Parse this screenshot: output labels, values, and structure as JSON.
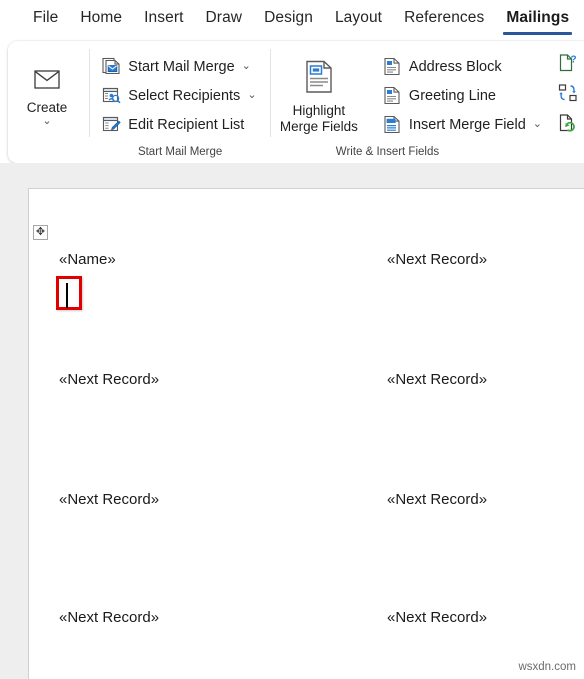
{
  "app": {
    "name": "Microsoft Word",
    "accent_color": "#2b579a"
  },
  "tabs": [
    {
      "label": "File",
      "active": false
    },
    {
      "label": "Home",
      "active": false
    },
    {
      "label": "Insert",
      "active": false
    },
    {
      "label": "Draw",
      "active": false
    },
    {
      "label": "Design",
      "active": false
    },
    {
      "label": "Layout",
      "active": false
    },
    {
      "label": "References",
      "active": false
    },
    {
      "label": "Mailings",
      "active": true
    }
  ],
  "ribbon": {
    "groups": [
      {
        "title": "Create",
        "big_button": {
          "label": "Create",
          "icon": "envelope-icon",
          "has_dropdown": true,
          "dropdown_glyph": "⌄"
        }
      },
      {
        "title": "Start Mail Merge",
        "items": [
          {
            "label": "Start Mail Merge",
            "icon": "start-mail-merge-icon",
            "has_dropdown": true,
            "dropdown_glyph": "⌄"
          },
          {
            "label": "Select Recipients",
            "icon": "select-recipients-icon",
            "has_dropdown": true,
            "dropdown_glyph": "⌄"
          },
          {
            "label": "Edit Recipient List",
            "icon": "edit-recipient-list-icon",
            "has_dropdown": false,
            "dropdown_glyph": ""
          }
        ]
      },
      {
        "title": "Write & Insert Fields",
        "big_button": {
          "label": "Highlight\nMerge Fields",
          "label_line1": "Highlight",
          "label_line2": "Merge Fields",
          "icon": "highlight-merge-fields-icon",
          "has_dropdown": false
        },
        "items": [
          {
            "label": "Address Block",
            "icon": "address-block-icon",
            "has_dropdown": false,
            "dropdown_glyph": ""
          },
          {
            "label": "Greeting Line",
            "icon": "greeting-line-icon",
            "has_dropdown": false,
            "dropdown_glyph": ""
          },
          {
            "label": "Insert Merge Field",
            "icon": "insert-merge-field-icon",
            "has_dropdown": true,
            "dropdown_glyph": "⌄"
          }
        ],
        "icon_only_items": [
          {
            "name": "rules-icon",
            "tooltip": "Rules"
          },
          {
            "name": "match-fields-icon",
            "tooltip": "Match Fields"
          },
          {
            "name": "update-labels-icon",
            "tooltip": "Update Labels"
          }
        ]
      }
    ]
  },
  "document": {
    "table_move_handle_glyph": "✥",
    "merge_field_name": "«Name»",
    "next_record_field": "«Next Record»",
    "cells": [
      {
        "row": 0,
        "col": 0,
        "text": "«Name»"
      },
      {
        "row": 0,
        "col": 1,
        "text": "«Next Record»"
      },
      {
        "row": 1,
        "col": 0,
        "text": "«Next Record»"
      },
      {
        "row": 1,
        "col": 1,
        "text": "«Next Record»"
      },
      {
        "row": 2,
        "col": 0,
        "text": "«Next Record»"
      },
      {
        "row": 2,
        "col": 1,
        "text": "«Next Record»"
      },
      {
        "row": 3,
        "col": 0,
        "text": "«Next Record»"
      },
      {
        "row": 3,
        "col": 1,
        "text": "«Next Record»"
      }
    ],
    "cursor_highlight_color": "#e00000",
    "watermark": "wsxdn.com"
  }
}
